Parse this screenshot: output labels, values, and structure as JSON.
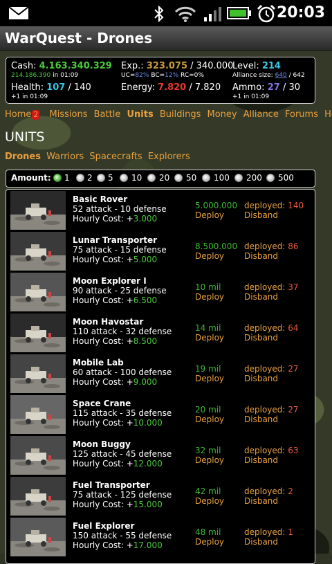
{
  "status_bar": {
    "time": "20:03"
  },
  "app": {
    "title": "WarQuest - Drones"
  },
  "stats": {
    "cash_label": "Cash:",
    "cash_value": "4.163.340.329",
    "cash_sub": "214.186.390",
    "cash_sub_time": "in 01:09",
    "exp_label": "Exp.:",
    "exp_value": "323.075",
    "exp_max": "/ 340.000",
    "uc_label": "UC=",
    "uc_value": "82%",
    "bc_label": "BC=",
    "bc_value": "12%",
    "rc_text": "RC=0%",
    "level_label": "Level:",
    "level_value": "214",
    "alliance_label": "Alliance size:",
    "alliance_value": "640",
    "alliance_max": "/ 642",
    "health_label": "Health:",
    "health_value": "107",
    "health_max": "/ 140",
    "health_sub": "+1 in 01:09",
    "energy_label": "Energy:",
    "energy_value": "7.820",
    "energy_max": "/ 7.820",
    "ammo_label": "Ammo:",
    "ammo_value": "27",
    "ammo_max": "/ 30",
    "ammo_sub": "+1 in 01:09"
  },
  "nav": {
    "home": "Home",
    "home_badge": "2",
    "missions": "Missions",
    "battle": "Battle",
    "units": "Units",
    "buildings": "Buildings",
    "money": "Money",
    "alliance": "Alliance",
    "forums": "Forums",
    "help": "Help"
  },
  "page_heading": "UNITS",
  "subnav": {
    "drones": "Drones",
    "warriors": "Warriors",
    "spacecrafts": "Spacecrafts",
    "explorers": "Explorers"
  },
  "amount": {
    "label": "Amount:",
    "options": [
      "1",
      "2",
      "5",
      "10",
      "20",
      "50",
      "100",
      "200",
      "500"
    ],
    "selected": "1"
  },
  "labels": {
    "hourly_cost": "Hourly Cost: ",
    "deploy": "Deploy",
    "deployed": "deployed: ",
    "disband": "Disband"
  },
  "units": [
    {
      "name": "Basic Rover",
      "stats": "52 attack - 10 defense",
      "cost_prefix": "+",
      "cost": "3.000",
      "price": "5.000.000",
      "deployed": "140"
    },
    {
      "name": "Lunar Transporter",
      "stats": "75 attack - 15 defense",
      "cost_prefix": "+",
      "cost": "5.000",
      "price": "8.500.000",
      "deployed": "86"
    },
    {
      "name": "Moon Explorer I",
      "stats": "90 attack - 25 defense",
      "cost_prefix": "+",
      "cost": "6.500",
      "price": "10 mil",
      "deployed": "37"
    },
    {
      "name": "Moon Havostar",
      "stats": "110 attack - 32 defense",
      "cost_prefix": "+",
      "cost": "8.500",
      "price": "14 mil",
      "deployed": "64"
    },
    {
      "name": "Mobile Lab",
      "stats": "60 attack - 100 defense",
      "cost_prefix": "+",
      "cost": "9.000",
      "price": "19 mil",
      "deployed": "27"
    },
    {
      "name": "Space Crane",
      "stats": "115 attack - 35 defense",
      "cost_prefix": "+",
      "cost": "10.000",
      "price": "20 mil",
      "deployed": "27"
    },
    {
      "name": "Moon Buggy",
      "stats": "125 attack - 45 defense",
      "cost_prefix": "+",
      "cost": "12.000",
      "price": "32 mil",
      "deployed": "63"
    },
    {
      "name": "Fuel Transporter",
      "stats": "75 attack - 125 defense",
      "cost_prefix": "+",
      "cost": "15.000",
      "price": "42 mil",
      "deployed": "2"
    },
    {
      "name": "Fuel Explorer",
      "stats": "150 attack - 55 defense",
      "cost_prefix": "+",
      "cost": "17.000",
      "price": "48 mil",
      "deployed": "1"
    }
  ]
}
